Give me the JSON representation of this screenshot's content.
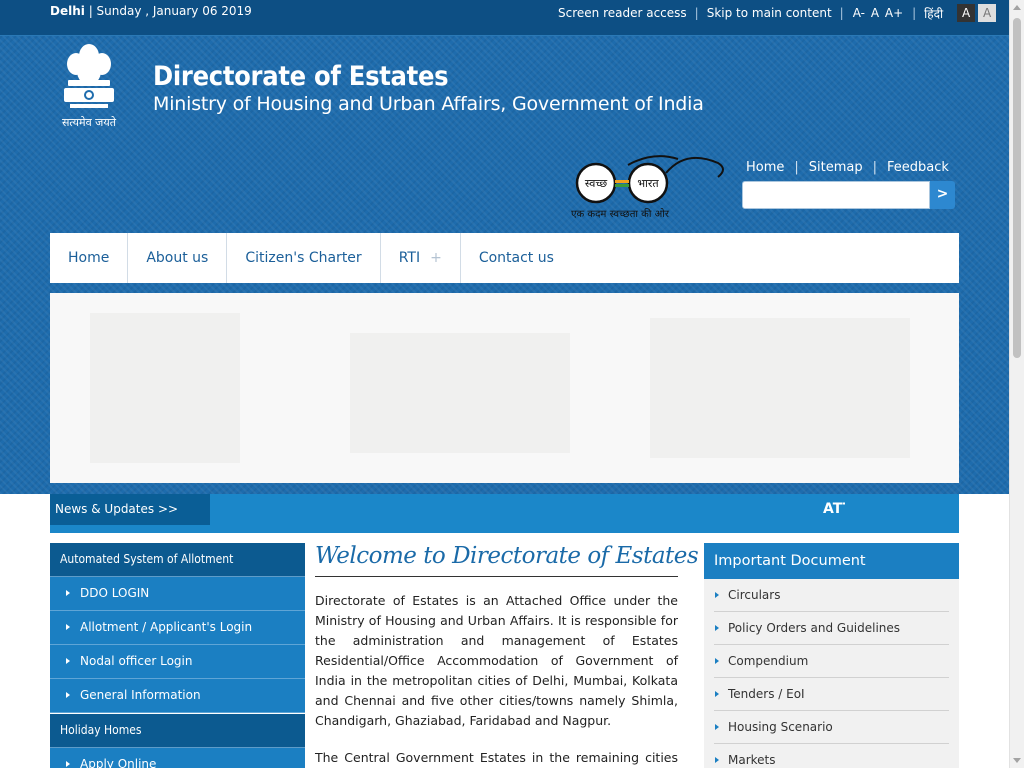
{
  "topbar": {
    "city": "Delhi",
    "date": "Sunday , January 06 2019",
    "screen_reader": "Screen reader access",
    "skip": "Skip to main content",
    "font_minus": "A-",
    "font_normal": "A",
    "font_plus": "A+",
    "hindi": "हिंदी",
    "theme_dark": "A",
    "theme_light": "A"
  },
  "header": {
    "title": "Directorate of Estates",
    "subtitle": "Ministry of Housing and Urban Affairs, Government of India",
    "emblem_motto": "सत्यमेव जयते",
    "swachh_left": "स्वच्छ",
    "swachh_right": "भारत",
    "swachh_tagline": "एक कदम स्वच्छता की ओर",
    "links": [
      "Home",
      "Sitemap",
      "Feedback"
    ],
    "search_value": "",
    "search_go": ">"
  },
  "nav": [
    "Home",
    "About us",
    "Citizen's Charter",
    "RTI",
    "Contact us"
  ],
  "news": {
    "label": "News & Updates >>",
    "ticker": "ATT"
  },
  "left": {
    "allotment_heading": "Automated System of Allotment",
    "allotment_items": [
      "DDO LOGIN",
      "Allotment / Applicant's Login",
      "Nodal officer Login",
      "General Information"
    ],
    "holiday_heading": "Holiday Homes",
    "holiday_items": [
      "Apply Online"
    ]
  },
  "center": {
    "welcome": "Welcome to Directorate of Estates",
    "para1": "Directorate of Estates is an Attached Office under the Ministry of Housing and Urban Affairs. It is responsible for the administration and management of Estates Residential/Office Accommodation of Government of India in the metropolitan cities of Delhi, Mumbai, Kolkata and Chennai and five other cities/towns namely Shimla, Chandigarh, Ghaziabad, Faridabad and Nagpur.",
    "para2": "The Central Government Estates in the remaining cities and"
  },
  "right": {
    "heading": "Important Document",
    "items": [
      "Circulars",
      "Policy Orders and Guidelines",
      "Compendium",
      "Tenders / EoI",
      "Housing Scenario",
      "Markets"
    ]
  },
  "colors": {
    "topbar": "#0d4f84",
    "header": "#1e6cad",
    "accent": "#1b7fc2",
    "dark_accent": "#0c5a90"
  }
}
